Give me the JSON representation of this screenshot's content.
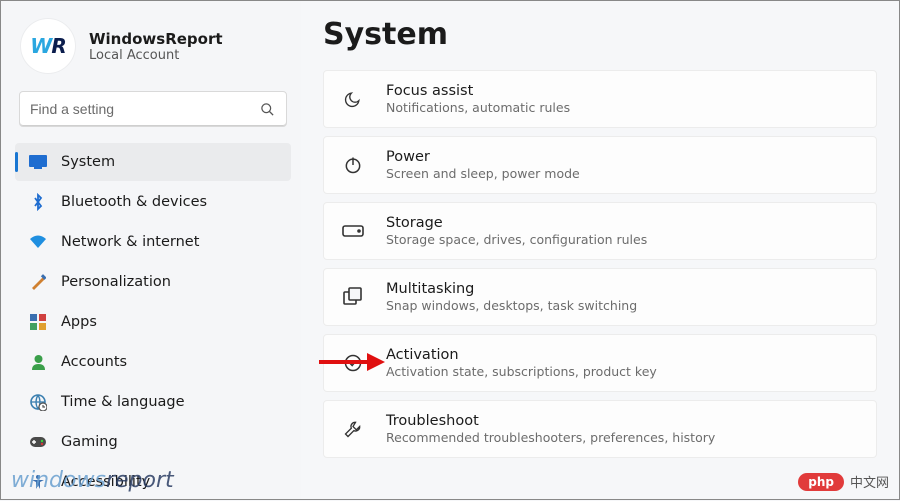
{
  "profile": {
    "name": "WindowsReport",
    "sub": "Local Account",
    "avatar_initials_w": "W",
    "avatar_initials_r": "R"
  },
  "search": {
    "placeholder": "Find a setting"
  },
  "sidebar": {
    "items": [
      {
        "label": "System",
        "icon": "display-icon",
        "active": true
      },
      {
        "label": "Bluetooth & devices",
        "icon": "bluetooth-icon"
      },
      {
        "label": "Network & internet",
        "icon": "wifi-icon"
      },
      {
        "label": "Personalization",
        "icon": "brush-icon"
      },
      {
        "label": "Apps",
        "icon": "apps-icon"
      },
      {
        "label": "Accounts",
        "icon": "person-icon"
      },
      {
        "label": "Time & language",
        "icon": "globe-clock-icon"
      },
      {
        "label": "Gaming",
        "icon": "gamepad-icon"
      },
      {
        "label": "Accessibility",
        "icon": "accessibility-icon"
      }
    ]
  },
  "page": {
    "title": "System"
  },
  "cards": [
    {
      "title": "Focus assist",
      "sub": "Notifications, automatic rules",
      "icon": "moon-icon"
    },
    {
      "title": "Power",
      "sub": "Screen and sleep, power mode",
      "icon": "power-icon"
    },
    {
      "title": "Storage",
      "sub": "Storage space, drives, configuration rules",
      "icon": "drive-icon"
    },
    {
      "title": "Multitasking",
      "sub": "Snap windows, desktops, task switching",
      "icon": "multitask-icon"
    },
    {
      "title": "Activation",
      "sub": "Activation state, subscriptions, product key",
      "icon": "check-circle-icon"
    },
    {
      "title": "Troubleshoot",
      "sub": "Recommended troubleshooters, preferences, history",
      "icon": "wrench-icon"
    }
  ],
  "watermark_left": {
    "part1": "windows",
    "part2": "report"
  },
  "watermark_right": {
    "badge": "php",
    "text": "中文网"
  }
}
